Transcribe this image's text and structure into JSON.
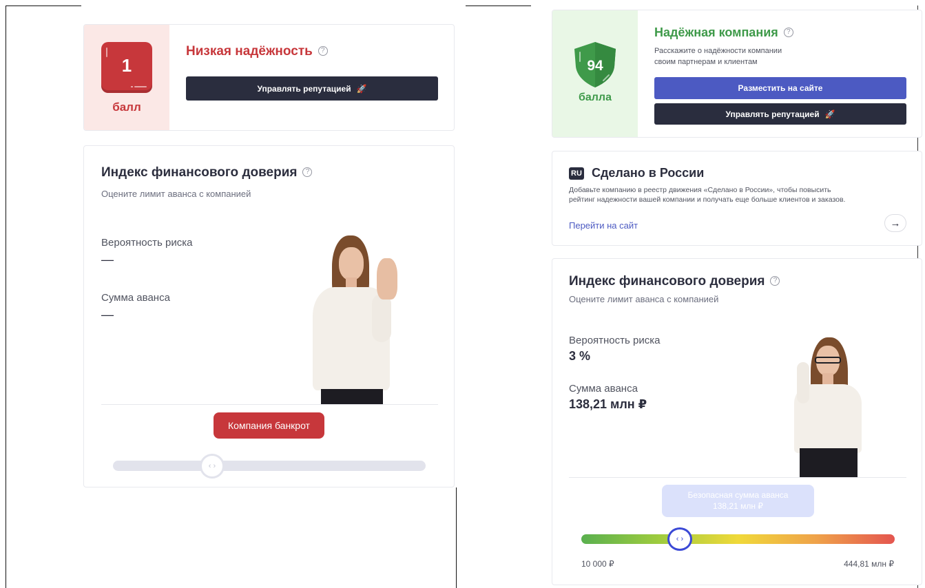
{
  "left": {
    "rating": {
      "score": "1",
      "unit": "балл",
      "status": "Низкая надёжность",
      "help": "?",
      "manage_btn": "Управлять репутацией"
    },
    "index": {
      "title": "Индекс финансового доверия",
      "help": "?",
      "subtitle": "Оцените лимит аванса с компанией",
      "risk_label": "Вероятность риска",
      "risk_value": "—",
      "advance_label": "Сумма аванса",
      "advance_value": "—",
      "status_pill": "Компания банкрот",
      "slider_position": 0.25
    }
  },
  "right": {
    "rating": {
      "score": "94",
      "unit": "балла",
      "status": "Надёжная компания",
      "help": "?",
      "description_line1": "Расскажите о надёжности компании",
      "description_line2": "своим партнерам и клиентам",
      "place_btn": "Разместить на сайте",
      "manage_btn": "Управлять репутацией"
    },
    "made_in_russia": {
      "badge": "RU",
      "title": "Сделано в России",
      "text_line1": "Добавьте компанию в реестр движения «Сделано в России», чтобы повысить",
      "text_line2": "рейтинг надежности вашей компании и получать еще больше клиентов и заказов.",
      "link": "Перейти на сайт",
      "arrow": "→"
    },
    "index": {
      "title": "Индекс финансового доверия",
      "help": "?",
      "subtitle": "Оцените лимит аванса с компанией",
      "risk_label": "Вероятность риска",
      "risk_value": "3 %",
      "advance_label": "Сумма аванса",
      "advance_value": "138,21 млн ₽",
      "safe_label": "Безопасная сумма аванса",
      "safe_value": "138,21 млн ₽",
      "slider_min": "10 000 ₽",
      "slider_max": "444,81 млн ₽",
      "slider_position": 0.3
    }
  },
  "icons": {
    "help": "help-circle-icon",
    "rocket": "rocket-icon",
    "arrow": "arrow-right-icon",
    "shield": "shield-icon",
    "slider": "chevrons-left-right-icon"
  },
  "colors": {
    "danger": "#c7373b",
    "success": "#3f9a4a",
    "primary": "#4c5ac2",
    "dark": "#2a2d3e",
    "danger_bg": "#fbe8e6",
    "success_bg": "#e9f7e6"
  }
}
